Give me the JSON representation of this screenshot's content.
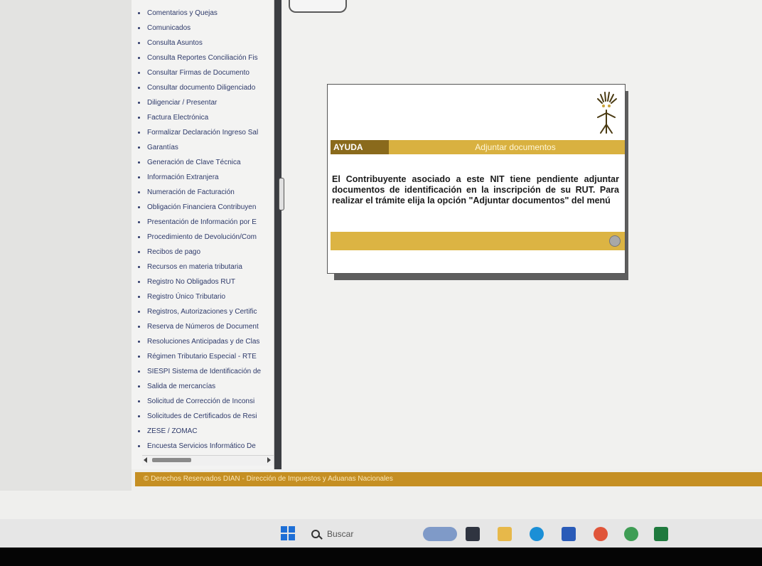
{
  "sidebar": {
    "items": [
      "Comentarios y Quejas",
      "Comunicados",
      "Consulta Asuntos",
      "Consulta Reportes Conciliación Fis",
      "Consultar Firmas de Documento",
      "Consultar documento Diligenciado",
      "Diligenciar / Presentar",
      "Factura Electrónica",
      "Formalizar Declaración Ingreso Sal",
      "Garantías",
      "Generación de Clave Técnica",
      "Información Extranjera",
      "Numeración de Facturación",
      "Obligación Financiera Contribuyen",
      "Presentación de Información por E",
      "Procedimiento de Devolución/Com",
      "Recibos de pago",
      "Recursos en materia tributaria",
      "Registro No Obligados RUT",
      "Registro Único Tributario",
      "Registros, Autorizaciones y Certific",
      "Reserva de Números de Document",
      "Resoluciones Anticipadas y de Clas",
      "Régimen Tributario Especial - RTE",
      "SIESPI Sistema de Identificación de",
      "Salida de mercancías",
      "Solicitud de Corrección de Inconsi",
      "Solicitudes de Certificados de Resi",
      "ZESE / ZOMAC",
      "Encuesta Servicios Informático De"
    ]
  },
  "help": {
    "tag": "AYUDA",
    "title": "Adjuntar documentos",
    "body": "El Contribuyente asociado a este NIT tiene pendiente adjuntar documentos de identificación en la inscripción de su RUT. Para realizar el trámite elija la opción \"Adjuntar documentos\" del menú"
  },
  "footer": {
    "text": "© Derechos Reservados DIAN - Dirección de Impuestos y Aduanas Nacionales"
  },
  "taskbar": {
    "search_label": "Buscar"
  },
  "colors": {
    "accent_gold": "#d9b140",
    "footer_gold": "#c58f23",
    "menu_text": "#2e3a6a"
  }
}
